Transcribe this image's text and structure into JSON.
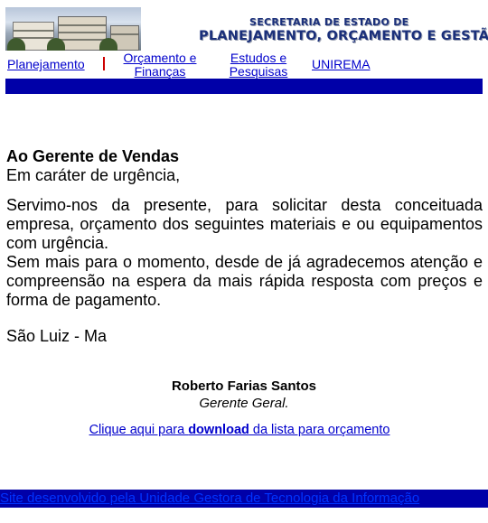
{
  "header": {
    "secretaria": "SECRETARIA DE ESTADO DE",
    "orgao": "PLANEJAMENTO, ORÇAMENTO E GESTÃO"
  },
  "nav": {
    "planejamento": "Planejamento",
    "orcamento_l1": "Orçamento e",
    "orcamento_l2": "Finanças",
    "estudos_l1": "Estudos e",
    "estudos_l2": "Pesquisas",
    "uniremа": "UNIREMA"
  },
  "letter": {
    "recipient": "Ao Gerente de Vendas",
    "urgency": "Em caráter de urgência,",
    "body1": "Servimo-nos da presente, para solicitar desta conceituada empresa, orçamento dos seguintes materiais e ou equipamentos com urgência.",
    "body2": "Sem mais para o momento, desde de já agradecemos atenção e compreensão na espera da mais rápida resposta com preços e forma de pagamento.",
    "city": "São Luiz - Ma",
    "signer_name": "Roberto Farias Santos",
    "signer_role": "Gerente Geral."
  },
  "download": {
    "prefix": "Clique aqui para ",
    "bold": "download",
    "suffix": " da lista para orçamento"
  },
  "footer": {
    "text": "Site desenvolvido pela Unidade Gestora de Tecnologia da Informação"
  },
  "colors": {
    "link": "#0000cc",
    "bar": "#0000a8",
    "title": "#1a2f7a"
  }
}
